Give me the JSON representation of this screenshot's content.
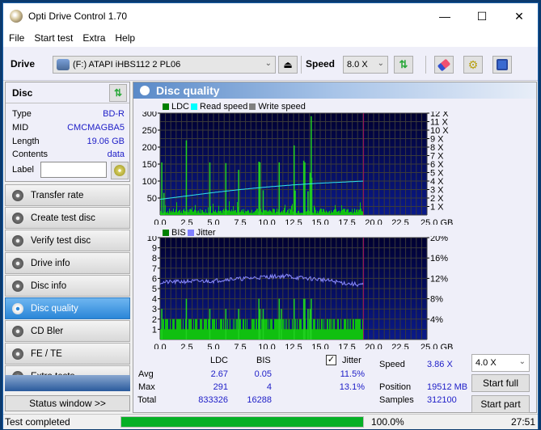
{
  "window": {
    "title": "Opti Drive Control 1.70",
    "controls": {
      "minimize": "—",
      "maximize": "☐",
      "close": "✕"
    }
  },
  "menu": [
    "File",
    "Start test",
    "Extra",
    "Help"
  ],
  "toolbar": {
    "drive_label": "Drive",
    "drive_value": "(F:)  ATAPI iHBS112   2 PL06",
    "speed_label": "Speed",
    "speed_value": "8.0 X",
    "icons": [
      "drive-icon",
      "eject-icon",
      "refresh-icon",
      "eraser-icon",
      "settings-icon",
      "save-icon"
    ]
  },
  "disc": {
    "header": "Disc",
    "rows": [
      {
        "label": "Type",
        "value": "BD-R"
      },
      {
        "label": "MID",
        "value": "CMCMAGBA5"
      },
      {
        "label": "Length",
        "value": "19.06 GB"
      },
      {
        "label": "Contents",
        "value": "data"
      }
    ],
    "label_field_label": "Label",
    "label_field_value": ""
  },
  "nav": [
    {
      "label": "Transfer rate",
      "active": false
    },
    {
      "label": "Create test disc",
      "active": false
    },
    {
      "label": "Verify test disc",
      "active": false
    },
    {
      "label": "Drive info",
      "active": false
    },
    {
      "label": "Disc info",
      "active": false
    },
    {
      "label": "Disc quality",
      "active": true
    },
    {
      "label": "CD Bler",
      "active": false
    },
    {
      "label": "FE / TE",
      "active": false
    },
    {
      "label": "Extra tests",
      "active": false
    }
  ],
  "status_window_button": "Status window >>",
  "panel": {
    "title": "Disc quality"
  },
  "chart_data": [
    {
      "type": "bar",
      "title": "LDC",
      "legend": [
        "LDC",
        "Read speed",
        "Write speed"
      ],
      "legend_colors": [
        "#008000",
        "#00ffff",
        "#808080"
      ],
      "x_ticks": [
        "0.0",
        "2.5",
        "5.0",
        "7.5",
        "10.0",
        "12.5",
        "15.0",
        "17.5",
        "20.0",
        "22.5",
        "25.0 GB"
      ],
      "xlim": [
        0,
        25
      ],
      "y_ticks": [
        "50",
        "100",
        "150",
        "200",
        "250",
        "300"
      ],
      "ylim": [
        0,
        300
      ],
      "y2_ticks": [
        "1 X",
        "2 X",
        "3 X",
        "4 X",
        "5 X",
        "6 X",
        "7 X",
        "8 X",
        "9 X",
        "10 X",
        "11 X",
        "12 X"
      ],
      "y2lim": [
        0,
        12
      ],
      "end_marker_gb": 19.06,
      "ldc_spikes": [
        [
          0.1,
          155
        ],
        [
          0.3,
          65
        ],
        [
          2.4,
          220
        ],
        [
          4.6,
          155
        ],
        [
          6.1,
          153
        ],
        [
          7.3,
          133
        ],
        [
          9.2,
          157
        ],
        [
          9.3,
          155
        ],
        [
          9.6,
          73
        ],
        [
          11.1,
          155
        ],
        [
          12.5,
          205
        ],
        [
          12.6,
          72
        ],
        [
          13.4,
          160
        ],
        [
          13.5,
          155
        ],
        [
          13.8,
          70
        ],
        [
          14.0,
          125
        ],
        [
          14.1,
          291
        ],
        [
          14.15,
          110
        ]
      ],
      "ldc_baseline": 12,
      "read_speed": [
        [
          0.0,
          1.85
        ],
        [
          2.5,
          2.25
        ],
        [
          5.0,
          2.65
        ],
        [
          7.5,
          3.0
        ],
        [
          10.0,
          3.3
        ],
        [
          12.5,
          3.55
        ],
        [
          15.0,
          3.75
        ],
        [
          17.5,
          3.9
        ],
        [
          19.06,
          4.0
        ]
      ]
    },
    {
      "type": "bar",
      "title": "BIS",
      "legend": [
        "BIS",
        "Jitter"
      ],
      "legend_colors": [
        "#008000",
        "#8080ff"
      ],
      "x_ticks": [
        "0.0",
        "2.5",
        "5.0",
        "7.5",
        "10.0",
        "12.5",
        "15.0",
        "17.5",
        "20.0",
        "22.5",
        "25.0 GB"
      ],
      "xlim": [
        0,
        25
      ],
      "y_ticks": [
        "1",
        "2",
        "3",
        "4",
        "5",
        "6",
        "7",
        "8",
        "9",
        "10"
      ],
      "ylim": [
        0,
        10
      ],
      "y2_ticks": [
        "4%",
        "8%",
        "12%",
        "16%",
        "20%"
      ],
      "y2lim": [
        0,
        20
      ],
      "end_marker_gb": 19.06,
      "bis_spikes": [
        [
          0.1,
          3
        ],
        [
          2.4,
          4
        ],
        [
          4.6,
          3
        ],
        [
          6.1,
          3
        ],
        [
          7.3,
          3
        ],
        [
          9.2,
          4
        ],
        [
          9.3,
          3
        ],
        [
          9.6,
          3
        ],
        [
          11.1,
          4
        ],
        [
          11.3,
          3
        ],
        [
          12.5,
          4
        ],
        [
          13.4,
          4
        ],
        [
          13.5,
          4
        ],
        [
          13.8,
          3
        ],
        [
          14.1,
          4
        ],
        [
          14.0,
          3
        ]
      ],
      "jitter": [
        [
          0.0,
          11.2
        ],
        [
          2.5,
          11.4
        ],
        [
          5.0,
          11.5
        ],
        [
          6.5,
          11.9
        ],
        [
          7.5,
          11.9
        ],
        [
          10.0,
          12.3
        ],
        [
          12.0,
          12.5
        ],
        [
          12.5,
          12.2
        ],
        [
          15.0,
          11.8
        ],
        [
          17.5,
          11.0
        ],
        [
          19.06,
          10.7
        ]
      ]
    }
  ],
  "stats": {
    "col_ldc": "LDC",
    "col_bis": "BIS",
    "jitter_label": "Jitter",
    "jitter_checked": true,
    "rows": [
      {
        "label": "Avg",
        "ldc": "2.67",
        "bis": "0.05",
        "jitter": "11.5%"
      },
      {
        "label": "Max",
        "ldc": "291",
        "bis": "4",
        "jitter": "13.1%"
      },
      {
        "label": "Total",
        "ldc": "833326",
        "bis": "16288",
        "jitter": ""
      }
    ],
    "speed_label": "Speed",
    "speed_value": "3.86 X",
    "position_label": "Position",
    "position_value": "19512 MB",
    "samples_label": "Samples",
    "samples_value": "312100",
    "test_speed": "4.0 X",
    "start_full": "Start full",
    "start_part": "Start part"
  },
  "statusbar": {
    "text": "Test completed",
    "progress_pct": 100,
    "progress_text": "100.0%",
    "time": "27:51"
  }
}
